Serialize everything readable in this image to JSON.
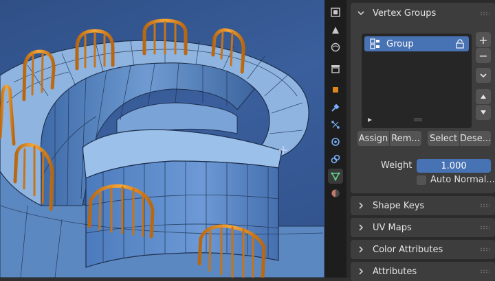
{
  "properties": {
    "vertex_groups": {
      "title": "Vertex Groups",
      "items": [
        {
          "label": "Group"
        }
      ],
      "buttons": {
        "assign": "Assign",
        "remove": "Rem...",
        "select": "Select",
        "deselect": "Dese..."
      },
      "weight_label": "Weight",
      "weight_value": "1.000",
      "auto_normalize_label": "Auto Normal..."
    },
    "shape_keys_title": "Shape Keys",
    "uv_maps_title": "UV Maps",
    "color_attributes_title": "Color Attributes",
    "attributes_title": "Attributes"
  },
  "icons": {
    "tabs": [
      "tool-icon",
      "render-icon",
      "output-icon",
      "world-icon",
      "collection-icon",
      "object-icon",
      "modifier-icon",
      "particles-icon",
      "physics-icon",
      "constraints-icon",
      "data-icon",
      "material-icon"
    ],
    "list": [
      "vertex-group-icon",
      "lock-icon"
    ],
    "side": [
      "add-icon",
      "remove-icon",
      "specials-chevron-icon",
      "move-up-icon",
      "move-down-icon"
    ]
  },
  "colors": {
    "accent": "#4772b3",
    "panel": "#3d3d3d",
    "mesh": "#8fb4e0",
    "railing": "#e3922a"
  }
}
